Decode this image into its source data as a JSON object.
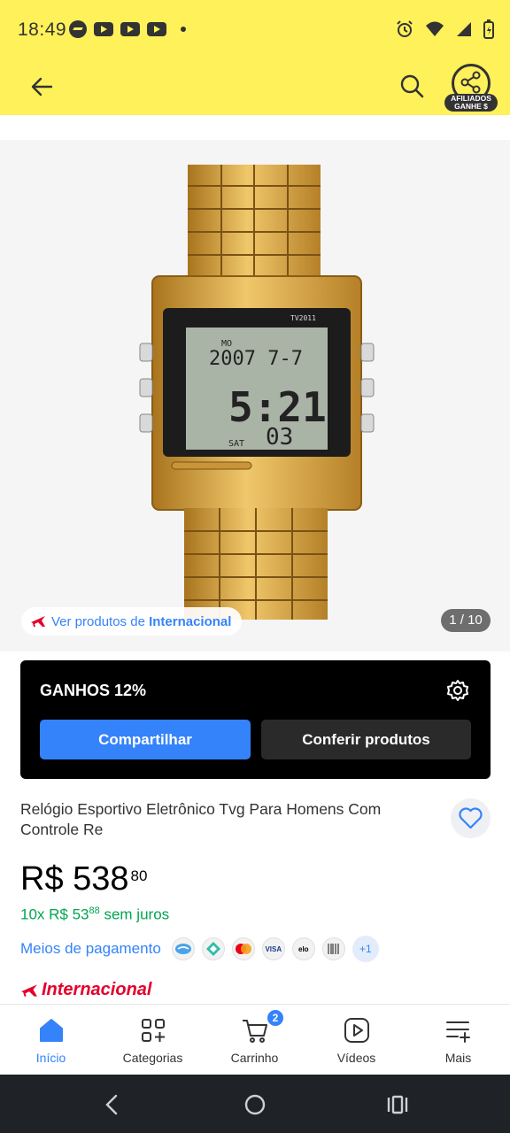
{
  "status_bar": {
    "time": "18:49"
  },
  "header": {
    "affiliate_badge_line1": "AFILIADOS",
    "affiliate_badge_line2": "GANHE $"
  },
  "gallery": {
    "intl_prefix": "Ver produtos de ",
    "intl_link": "Internacional",
    "counter": "1 / 10",
    "watch_text_brand": "TV2011",
    "watch_text_day": "MO",
    "watch_text_date": "2007 7-7",
    "watch_text_time": "5:21",
    "watch_text_sec": "03",
    "watch_text_sat": "SAT"
  },
  "affiliate_panel": {
    "title": "GANHOS 12%",
    "share_label": "Compartilhar",
    "check_label": "Conferir produtos"
  },
  "product": {
    "title": "Relógio Esportivo Eletrônico Tvg Para Homens Com Controle Re",
    "currency_price": "R$ 538",
    "cents": "80",
    "installments_prefix": "10x R$ 53",
    "installments_cents": "88",
    "installments_suffix": " sem juros",
    "payment_link": "Meios de pagamento",
    "payment_more": "+1",
    "intl_badge": "Internacional"
  },
  "tabs": [
    {
      "label": "Início"
    },
    {
      "label": "Categorias"
    },
    {
      "label": "Carrinho",
      "badge": "2"
    },
    {
      "label": "Vídeos"
    },
    {
      "label": "Mais"
    }
  ],
  "colors": {
    "brand_yellow": "#fff159",
    "accent_blue": "#3483fa",
    "green": "#00a650",
    "intl_red": "#e4002b"
  }
}
